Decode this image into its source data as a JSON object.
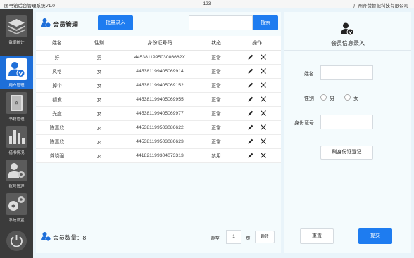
{
  "window": {
    "title": "图书馆后台管理系统V1.0",
    "center_text": "123",
    "company": "广州弃赞智能科技有限公司"
  },
  "sidebar": {
    "items": [
      {
        "label": "数据统计",
        "icon": "stack-icon",
        "active": false
      },
      {
        "label": "用户管理",
        "icon": "user-icon",
        "active": true
      },
      {
        "label": "书籍管理",
        "icon": "book-icon",
        "active": false
      },
      {
        "label": "借书情况",
        "icon": "bar-chart-icon",
        "active": false
      },
      {
        "label": "账号管理",
        "icon": "user-gear-icon",
        "active": false
      },
      {
        "label": "系统设置",
        "icon": "gears-icon",
        "active": false
      }
    ],
    "power_icon": "power-icon"
  },
  "members": {
    "title": "会员管理",
    "batch_button": "批量录入",
    "search_placeholder": "",
    "search_button": "搜索",
    "columns": [
      "姓名",
      "性别",
      "身份证号码",
      "状态",
      "操作"
    ],
    "rows": [
      {
        "name": "好",
        "gender": "男",
        "id_number": "445381199503086662X",
        "status": "正常"
      },
      {
        "name": "风格",
        "gender": "女",
        "id_number": "445381199405069914",
        "status": "正常"
      },
      {
        "name": "掉个",
        "gender": "女",
        "id_number": "445381199405069152",
        "status": "正常"
      },
      {
        "name": "额发",
        "gender": "女",
        "id_number": "445381199405069955",
        "status": "正常"
      },
      {
        "name": "光度",
        "gender": "女",
        "id_number": "445381199405069977",
        "status": "正常"
      },
      {
        "name": "陈嘉欣",
        "gender": "女",
        "id_number": "445381199503086622",
        "status": "正常"
      },
      {
        "name": "陈嘉欣",
        "gender": "女",
        "id_number": "445381199503086623",
        "status": "正常"
      },
      {
        "name": "龚晓强",
        "gender": "女",
        "id_number": "441821199304073313",
        "status": "禁用"
      }
    ],
    "count_label": "会员数量：8",
    "pagination": {
      "goto_label": "跳至",
      "page_value": "1",
      "page_unit": "页",
      "jump_button": "跳转"
    }
  },
  "form": {
    "title": "会员信息录入",
    "name_label": "姓名",
    "gender_label": "性别",
    "gender_options": [
      "男",
      "女"
    ],
    "id_label": "身份证号",
    "swipe_button": "刷身份证登记",
    "reset_button": "重置",
    "submit_button": "提交"
  },
  "colors": {
    "accent": "#1e7cf0",
    "sidebar_bg": "#3b3b3b",
    "active_nav": "#1e6fd9"
  }
}
